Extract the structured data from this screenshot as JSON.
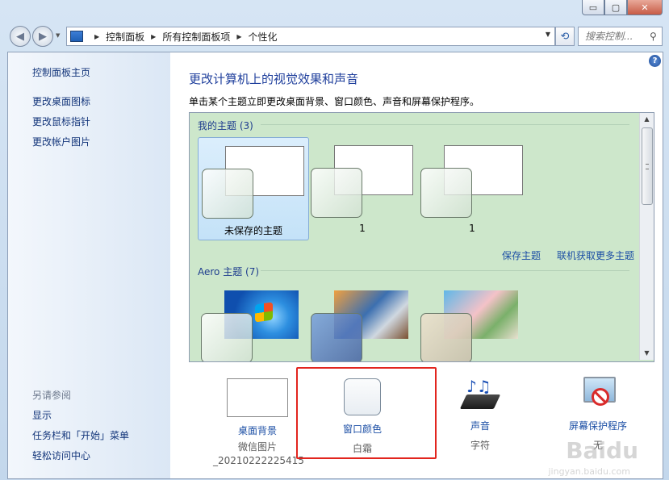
{
  "window": {
    "caption_minimize": "▭",
    "caption_maximize": "▢",
    "caption_close": "✕"
  },
  "breadcrumb": [
    "控制面板",
    "所有控制面板项",
    "个性化"
  ],
  "search": {
    "placeholder": "搜索控制..."
  },
  "sidebar": {
    "home": "控制面板主页",
    "links": [
      "更改桌面图标",
      "更改鼠标指针",
      "更改帐户图片"
    ],
    "see_also_label": "另请参阅",
    "see_also": [
      "显示",
      "任务栏和「开始」菜单",
      "轻松访问中心"
    ]
  },
  "main": {
    "title": "更改计算机上的视觉效果和声音",
    "description": "单击某个主题立即更改桌面背景、窗口颜色、声音和屏幕保护程序。"
  },
  "my_themes": {
    "label": "我的主题 (3)",
    "items": [
      {
        "name": "未保存的主题"
      },
      {
        "name": "1"
      },
      {
        "name": "1"
      }
    ],
    "save_link": "保存主题",
    "online_link": "联机获取更多主题"
  },
  "aero_themes": {
    "label": "Aero 主题 (7)"
  },
  "bottom": {
    "desktop_bg": {
      "label": "桌面背景",
      "sub1": "微信图片",
      "sub2": "_20210222225415"
    },
    "window_color": {
      "label": "窗口颜色",
      "sub": "白霜"
    },
    "sounds": {
      "label": "声音",
      "sub": "字符"
    },
    "screensaver": {
      "label": "屏幕保护程序",
      "sub": "无"
    }
  },
  "watermark": {
    "text": "Baidu",
    "sub": "jingyan.baidu.com"
  },
  "colors": {
    "accent": "#1f3f9c",
    "link": "#1c4fa5",
    "highlight": "#e2251e",
    "theme_panel": "#cde7cb"
  }
}
